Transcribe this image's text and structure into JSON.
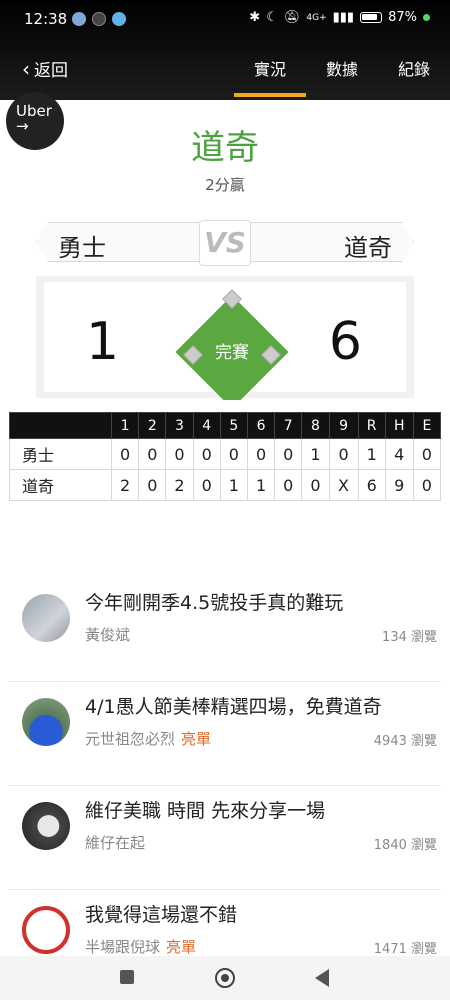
{
  "status_bar": {
    "time": "12:38",
    "battery": "87%",
    "signal": "4G+"
  },
  "nav": {
    "back_label": "返回",
    "tabs": [
      "實況",
      "數據",
      "紀錄"
    ],
    "active_tab": 0
  },
  "ad": {
    "label": "Uber",
    "arrow": "→"
  },
  "result": {
    "winner": "道奇",
    "margin": "2分贏"
  },
  "matchup": {
    "away": "勇士",
    "home": "道奇",
    "vs": "VS"
  },
  "score": {
    "away": "1",
    "home": "6",
    "status": "完賽"
  },
  "box_score": {
    "headers": [
      "",
      "1",
      "2",
      "3",
      "4",
      "5",
      "6",
      "7",
      "8",
      "9",
      "R",
      "H",
      "E"
    ],
    "rows": [
      [
        "勇士",
        "0",
        "0",
        "0",
        "0",
        "0",
        "0",
        "0",
        "1",
        "0",
        "1",
        "4",
        "0"
      ],
      [
        "道奇",
        "2",
        "0",
        "2",
        "0",
        "1",
        "1",
        "0",
        "0",
        "X",
        "6",
        "9",
        "0"
      ]
    ]
  },
  "feed": [
    {
      "title": "今年剛開季4.5號投手真的難玩",
      "author": "黃俊斌",
      "tag": "",
      "views": "134 瀏覽"
    },
    {
      "title": "4/1愚人節美棒精選四場，免費道奇",
      "author": "元世祖忽必烈",
      "tag": "亮單",
      "views": "4943 瀏覽"
    },
    {
      "title": "維仔美職 時間 先來分享一場",
      "author": "維仔在起",
      "tag": "",
      "views": "1840 瀏覽"
    },
    {
      "title": "我覺得這場還不錯",
      "author": "半場跟倪球",
      "tag": "亮單",
      "views": "1471 瀏覽"
    }
  ]
}
